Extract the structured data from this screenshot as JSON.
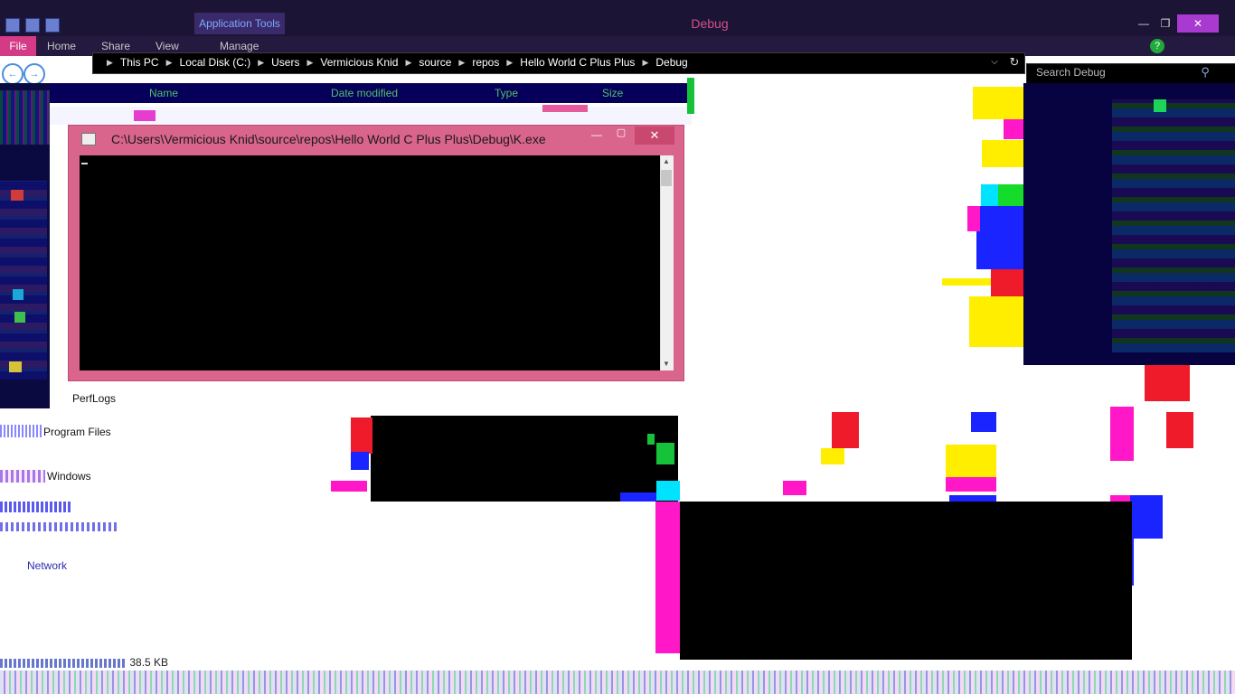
{
  "window": {
    "title": "Debug",
    "contextual_tab": "Application Tools"
  },
  "ribbon": {
    "tabs": [
      "File",
      "Home",
      "Share",
      "View",
      "Manage"
    ]
  },
  "address": {
    "crumbs": [
      "This PC",
      "Local Disk (C:)",
      "Users",
      "Vermicious Knid",
      "source",
      "repos",
      "Hello World C Plus Plus",
      "Debug"
    ]
  },
  "search": {
    "placeholder": "Search Debug"
  },
  "columns": {
    "name": "Name",
    "date_modified": "Date modified",
    "type": "Type",
    "size": "Size"
  },
  "nav_lower": {
    "perflogs": "PerfLogs",
    "program_files": "Program Files",
    "windows": "Windows",
    "network": "Network"
  },
  "console": {
    "title": "C:\\Users\\Vermicious Knid\\source\\repos\\Hello World C Plus Plus\\Debug\\K.exe"
  },
  "status": {
    "size": "38.5 KB"
  },
  "colors": {
    "titlebar": "#1b1435",
    "console_frame": "#d9648c",
    "accent_file_tab": "#d43a86",
    "breadcrumb_bar": "#000000",
    "column_header_text": "#4ec06a"
  }
}
